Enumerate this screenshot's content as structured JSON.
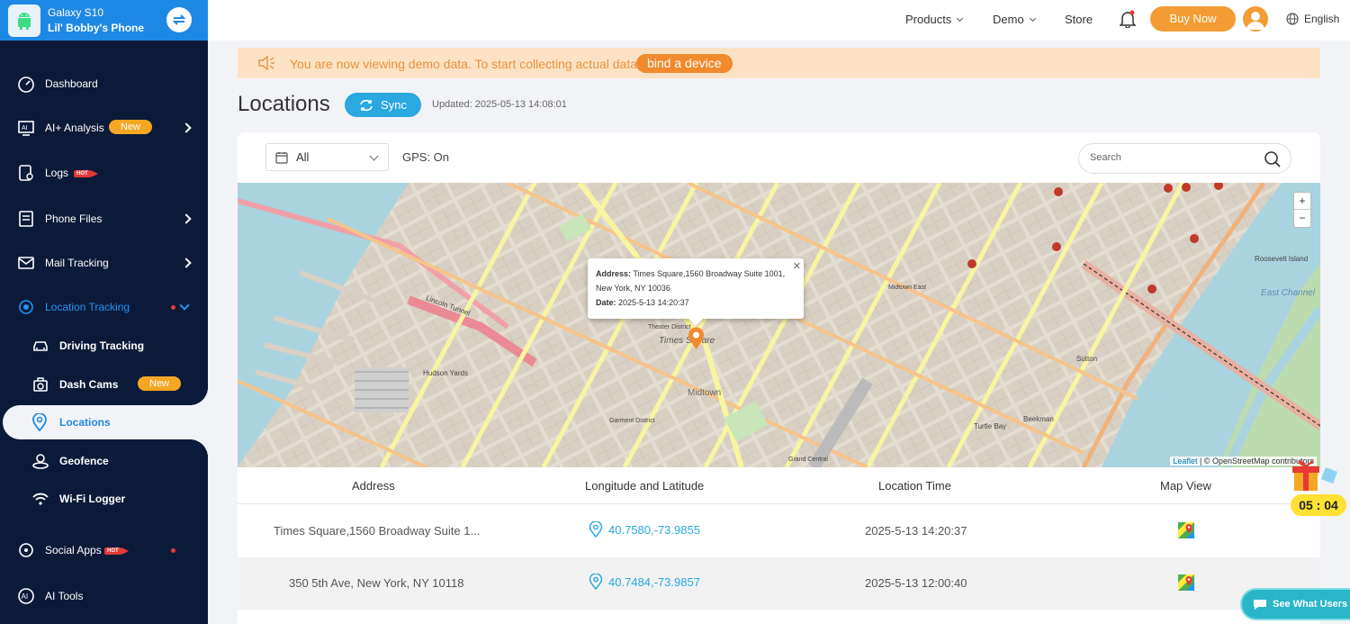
{
  "device": {
    "name": "Galaxy S10",
    "owner": "Lil' Bobby's Phone"
  },
  "sidebar": {
    "items": [
      {
        "label": "Dashboard"
      },
      {
        "label": "AI+ Analysis",
        "badge": "New"
      },
      {
        "label": "Logs",
        "badge": "HOT"
      },
      {
        "label": "Phone Files"
      },
      {
        "label": "Mail Tracking"
      },
      {
        "label": "Location Tracking"
      },
      {
        "label": "Driving Tracking"
      },
      {
        "label": "Dash Cams",
        "badge": "New"
      },
      {
        "label": "Locations"
      },
      {
        "label": "Geofence"
      },
      {
        "label": "Wi-Fi Logger"
      },
      {
        "label": "Social Apps",
        "badge": "HOT"
      },
      {
        "label": "AI Tools"
      }
    ]
  },
  "header": {
    "products": "Products",
    "demo": "Demo",
    "store": "Store",
    "buy_now": "Buy Now",
    "language": "English"
  },
  "banner": {
    "text": "You are now viewing demo data. To start collecting actual data,",
    "button": "bind a device"
  },
  "page": {
    "title": "Locations",
    "sync": "Sync",
    "updated": "Updated: 2025-05-13 14:08:01"
  },
  "filters": {
    "date_range": "All",
    "gps": "GPS: On",
    "search_placeholder": "Search"
  },
  "map": {
    "popup": {
      "address_label": "Address:",
      "address_line1": "Times Square,1560 Broadway Suite 1001,",
      "address_line2": "New York, NY 10036",
      "date_label": "Date:",
      "date": "2025-5-13 14:20:37"
    },
    "zoom_in": "+",
    "zoom_out": "−",
    "attribution_leaflet": "Leaflet",
    "attribution_rest": "| © OpenStreetMap contributors",
    "labels": [
      {
        "text": "Times Square"
      },
      {
        "text": "Midtown"
      },
      {
        "text": "Hudson Yards"
      },
      {
        "text": "Lincoln Tunnel"
      },
      {
        "text": "Theater District"
      },
      {
        "text": "Midtown East"
      },
      {
        "text": "Roosevelt Island"
      },
      {
        "text": "Sutton"
      },
      {
        "text": "Turtle Bay"
      },
      {
        "text": "Beekman"
      },
      {
        "text": "East Channel"
      },
      {
        "text": "Garment District"
      },
      {
        "text": "Grand Central"
      }
    ]
  },
  "table": {
    "columns": [
      "Address",
      "Longitude and Latitude",
      "Location Time",
      "Map View"
    ],
    "rows": [
      {
        "address": "Times Square,1560 Broadway Suite 1...",
        "coords": "40.7580,-73.9855",
        "time": "2025-5-13 14:20:37"
      },
      {
        "address": "350 5th Ave, New York, NY 10118",
        "coords": "40.7484,-73.9857",
        "time": "2025-5-13 12:00:40"
      }
    ]
  },
  "timer": "05 : 04",
  "chat_button": "See What Users Sa",
  "colors": {
    "sidebar": "#0c1a3a",
    "accent_blue": "#1e88e5",
    "orange": "#f39c33",
    "teal": "#2aa8e0"
  }
}
